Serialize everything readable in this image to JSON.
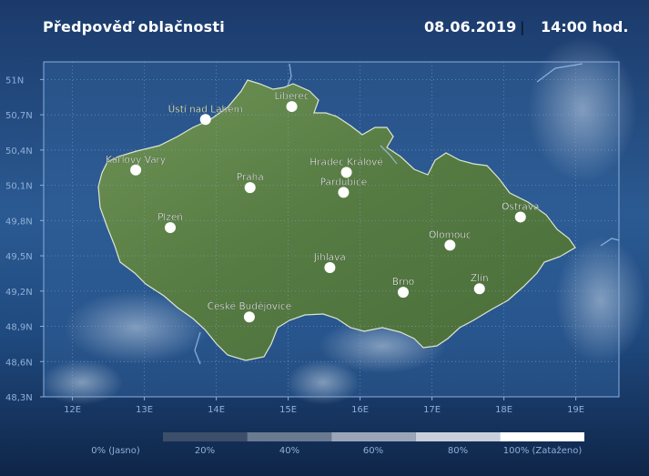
{
  "header": {
    "title": "Předpověď oblačnosti",
    "date": "08.06.2019",
    "separator": "|",
    "time": "14:00 hod."
  },
  "axes": {
    "lat_labels": [
      "51N",
      "50,7N",
      "50,4N",
      "50,1N",
      "49,8N",
      "49,5N",
      "49,2N",
      "48,9N",
      "48,6N",
      "48,3N"
    ],
    "lat_values": [
      51.0,
      50.7,
      50.4,
      50.1,
      49.8,
      49.5,
      49.2,
      48.9,
      48.6,
      48.3
    ],
    "lon_labels": [
      "12E",
      "13E",
      "14E",
      "15E",
      "16E",
      "17E",
      "18E",
      "19E"
    ],
    "lon_values": [
      12,
      13,
      14,
      15,
      16,
      17,
      18,
      19
    ],
    "lat_range": [
      48.3,
      51.0
    ],
    "lon_range": [
      11.6,
      19.6
    ]
  },
  "cities": [
    {
      "name": "Ústí nad Labem",
      "lon": 13.85,
      "lat": 50.66
    },
    {
      "name": "Liberec",
      "lon": 15.05,
      "lat": 50.77
    },
    {
      "name": "Karlovy Vary",
      "lon": 12.88,
      "lat": 50.23
    },
    {
      "name": "Praha",
      "lon": 14.47,
      "lat": 50.08
    },
    {
      "name": "Hradec Králové",
      "lon": 15.81,
      "lat": 50.21
    },
    {
      "name": "Pardubice",
      "lon": 15.77,
      "lat": 50.04
    },
    {
      "name": "Plzeň",
      "lon": 13.36,
      "lat": 49.74
    },
    {
      "name": "Ostrava",
      "lon": 18.23,
      "lat": 49.83
    },
    {
      "name": "Olomouc",
      "lon": 17.25,
      "lat": 49.59
    },
    {
      "name": "Jihlava",
      "lon": 15.58,
      "lat": 49.4
    },
    {
      "name": "Brno",
      "lon": 16.6,
      "lat": 49.19
    },
    {
      "name": "Zlín",
      "lon": 17.66,
      "lat": 49.22
    },
    {
      "name": "České Budějovice",
      "lon": 14.46,
      "lat": 48.98
    }
  ],
  "legend": {
    "labels": [
      "0% (Jasno)",
      "20%",
      "40%",
      "60%",
      "80%",
      "100% (Zataženo)"
    ],
    "colors": [
      "#3c4e6a",
      "#6a7a90",
      "#9aa6b8",
      "#c8cfdb",
      "#ffffff"
    ]
  },
  "colors": {
    "land": "#5a8046",
    "border": "#dfe6d0",
    "frame": "#8aaedc",
    "rivers": "#9fc2ee",
    "city_dot": "#ffffff"
  }
}
